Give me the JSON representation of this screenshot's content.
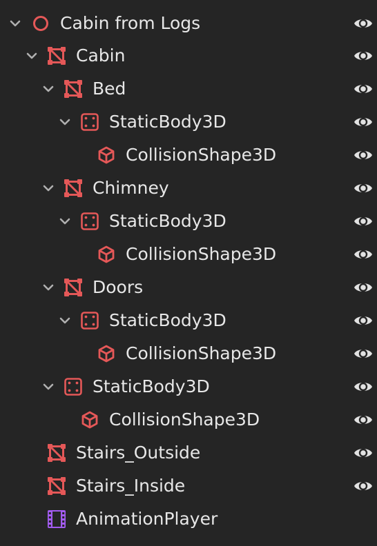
{
  "colors": {
    "background": "#252525",
    "text": "#e7e7e7",
    "node_icon": "#e55858",
    "animation_icon": "#a35cf0",
    "chevron": "#b0b0b0",
    "eye": "#e2e2e2"
  },
  "scene_tree": {
    "nodes": [
      {
        "label": "Cabin from Logs",
        "icon": "node3d-circle-icon",
        "expanded": true,
        "visible": true
      },
      {
        "label": "Cabin",
        "icon": "mesh-instance-icon",
        "expanded": true,
        "visible": true
      },
      {
        "label": "Bed",
        "icon": "mesh-instance-icon",
        "expanded": true,
        "visible": true
      },
      {
        "label": "StaticBody3D",
        "icon": "static-body-icon",
        "expanded": true,
        "visible": true
      },
      {
        "label": "CollisionShape3D",
        "icon": "collision-shape-icon",
        "visible": true
      },
      {
        "label": "Chimney",
        "icon": "mesh-instance-icon",
        "expanded": true,
        "visible": true
      },
      {
        "label": "StaticBody3D",
        "icon": "static-body-icon",
        "expanded": true,
        "visible": true
      },
      {
        "label": "CollisionShape3D",
        "icon": "collision-shape-icon",
        "visible": true
      },
      {
        "label": "Doors",
        "icon": "mesh-instance-icon",
        "expanded": true,
        "visible": true
      },
      {
        "label": "StaticBody3D",
        "icon": "static-body-icon",
        "expanded": true,
        "visible": true
      },
      {
        "label": "CollisionShape3D",
        "icon": "collision-shape-icon",
        "visible": true
      },
      {
        "label": "StaticBody3D",
        "icon": "static-body-icon",
        "expanded": true,
        "visible": true
      },
      {
        "label": "CollisionShape3D",
        "icon": "collision-shape-icon",
        "visible": true
      },
      {
        "label": "Stairs_Outside",
        "icon": "mesh-instance-icon",
        "visible": true
      },
      {
        "label": "Stairs_Inside",
        "icon": "mesh-instance-icon",
        "visible": true
      },
      {
        "label": "AnimationPlayer",
        "icon": "animation-player-icon"
      }
    ]
  }
}
